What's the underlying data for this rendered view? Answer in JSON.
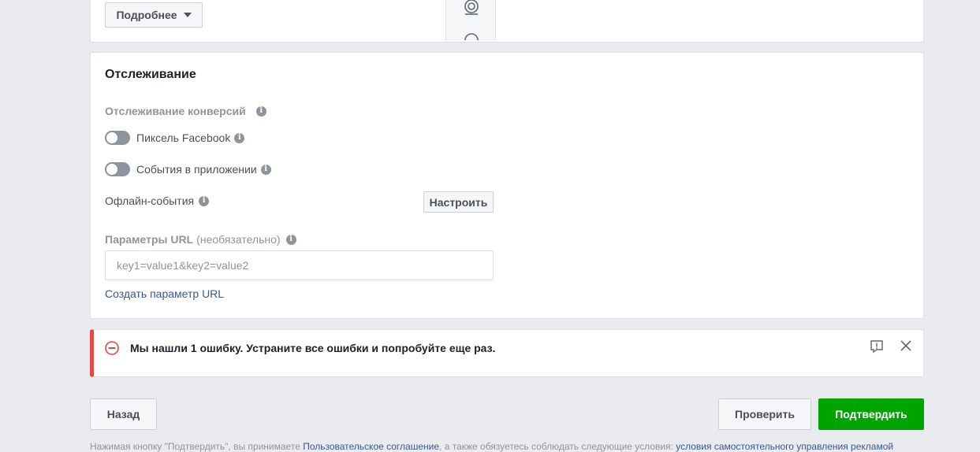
{
  "top_section": {
    "more_button_label": "Подробнее"
  },
  "tracking": {
    "title": "Отслеживание",
    "conversion_tracking_label": "Отслеживание конверсий",
    "pixel_label": "Пиксель Facebook",
    "app_events_label": "События в приложении",
    "offline_events_label": "Офлайн-события",
    "configure_button_label": "Настроить",
    "url_params_label": "Параметры URL",
    "url_params_optional": "(необязательно)",
    "url_params_placeholder": "key1=value1&key2=value2",
    "create_url_param_link": "Создать параметр URL"
  },
  "error_banner": {
    "message": "Мы нашли 1 ошибку. Устраните все ошибки и попробуйте еще раз."
  },
  "footer": {
    "back_label": "Назад",
    "check_label": "Проверить",
    "confirm_label": "Подтвердить",
    "note_prefix": "Нажимая кнопку \"Подтвердить\", вы принимаете ",
    "terms_link": "Пользовательское соглашение",
    "note_middle": ", а также обязуетесь соблюдать следующие условия: ",
    "self_serve_link": "условия самостоятельного управления рекламой"
  },
  "colors": {
    "confirm_button": "#00a400",
    "error_accent": "#e04a42",
    "link": "#365899"
  }
}
